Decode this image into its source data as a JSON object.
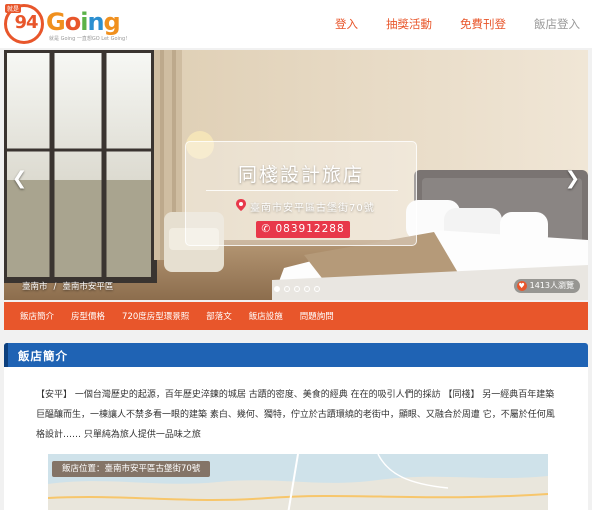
{
  "header": {
    "logo": {
      "badge_text": "94",
      "tag_text": "就是",
      "word": "Going",
      "slogan": "就是 Going 一直想GO Let Going!"
    },
    "nav": [
      {
        "label": "登入"
      },
      {
        "label": "抽獎活動"
      },
      {
        "label": "免費刊登"
      },
      {
        "label": "飯店登入"
      }
    ]
  },
  "hero": {
    "title": "同棧設計旅店",
    "address": "臺南市安平區古堡街70號",
    "phone": "083912288",
    "breadcrumb": [
      "臺南市",
      "臺南市安平區"
    ],
    "views": "1413人瀏覽",
    "slide_count": 5,
    "active_slide": 0,
    "prev_icon": "chevron-left-icon",
    "next_icon": "chevron-right-icon"
  },
  "tabs": [
    "飯店簡介",
    "房型價格",
    "720度房型環景照",
    "部落文",
    "飯店設施",
    "問題詢問"
  ],
  "intro": {
    "heading": "飯店簡介",
    "text": "【安平】 一個台灣歷史的起源，百年歷史淬鍊的城居 古蹟的密度、美食的經典 在在的吸引人們的採訪 【同棧】 另一經典百年建築巨醞釀而生，一棟讓人不禁多看一眼的建築 素白、幾何、獨特，佇立於古蹟環繞的老街中，顯眼、又融合於周遭 它，不屬於任何風格設計…… 只單純為旅人提供一品味之旅",
    "map_label": "飯店位置：臺南市安平區古堡街70號"
  },
  "colors": {
    "brand": "#e8562b",
    "section_header": "#1f63b4",
    "phone_button": "#e8384a"
  }
}
